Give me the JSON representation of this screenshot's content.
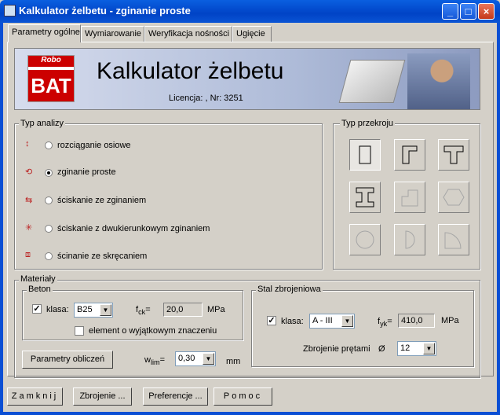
{
  "window": {
    "title": "Kalkulator żelbetu - zginanie proste",
    "controls": [
      "minimize",
      "maximize",
      "close"
    ]
  },
  "tabs": [
    "Parametry ogólne",
    "Wymiarowanie",
    "Weryfikacja nośności",
    "Ugięcie"
  ],
  "banner": {
    "logo_top": "Robo",
    "logo_main": "BAT",
    "title": "Kalkulator żelbetu",
    "license": "Licencja:  , Nr: 3251"
  },
  "analysis": {
    "label": "Typ analizy",
    "options": [
      {
        "label": "rozciąganie osiowe",
        "selected": false
      },
      {
        "label": "zginanie proste",
        "selected": true
      },
      {
        "label": "ściskanie ze zginaniem",
        "selected": false
      },
      {
        "label": "ściskanie z dwukierunkowym zginaniem",
        "selected": false
      },
      {
        "label": "ścinanie ze skręcaniem",
        "selected": false
      }
    ]
  },
  "section": {
    "label": "Typ przekroju",
    "shapes": [
      "rectangle",
      "l-section",
      "t-section",
      "i-section",
      "stepped-section",
      "hexagon",
      "circle",
      "half-circle",
      "quarter-circle"
    ],
    "enabled": [
      true,
      true,
      true,
      true,
      false,
      false,
      false,
      false,
      false
    ],
    "selected": "rectangle"
  },
  "materials": {
    "label": "Materiały",
    "beton": {
      "label": "Beton",
      "class_checkbox_label": "klasa:",
      "class_checked": true,
      "class_value": "B25",
      "fck_label": "f",
      "fck_sub": "ck",
      "fck_eq": "=",
      "fck_value": "20,0",
      "fck_unit": "MPa",
      "special_label": "element o wyjątkowym znaczeniu",
      "special_checked": false
    },
    "stal": {
      "label": "Stal zbrojeniowa",
      "class_checkbox_label": "klasa:",
      "class_checked": true,
      "class_value": "A - III",
      "fyk_label": "f",
      "fyk_sub": "yk",
      "fyk_eq": "=",
      "fyk_value": "410,0",
      "fyk_unit": "MPa",
      "bars_label": "Zbrojenie prętami",
      "bars_symbol": "Ø",
      "bars_value": "12"
    },
    "calc_button": "Parametry obliczeń",
    "wlim_label": "w",
    "wlim_sub": "lim",
    "wlim_eq": "=",
    "wlim_value": "0,30",
    "wlim_unit": "mm"
  },
  "footer": {
    "close": "Zamknij",
    "reinforcement": "Zbrojenie ...",
    "preferences": "Preferencje ...",
    "help": "Pomoc"
  }
}
